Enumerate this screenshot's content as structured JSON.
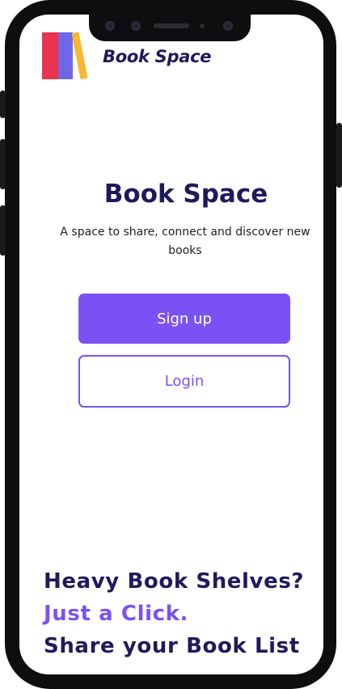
{
  "app": {
    "name": "Book Space"
  },
  "hero": {
    "title": "Book Space",
    "subtitle": "A space to share, connect and discover new books"
  },
  "actions": {
    "signup_label": "Sign up",
    "login_label": "Login"
  },
  "tagline": {
    "line1": "Heavy Book Shelves?",
    "line2": "Just a Click.",
    "line3": "Share your Book List"
  },
  "colors": {
    "brand_dark": "#1f1a5c",
    "accent": "#7a52f4",
    "logo_red": "#e8344e",
    "logo_violet": "#7067e6",
    "logo_yellow": "#f7b731"
  },
  "icons": {
    "logo": "books-logo-icon"
  }
}
